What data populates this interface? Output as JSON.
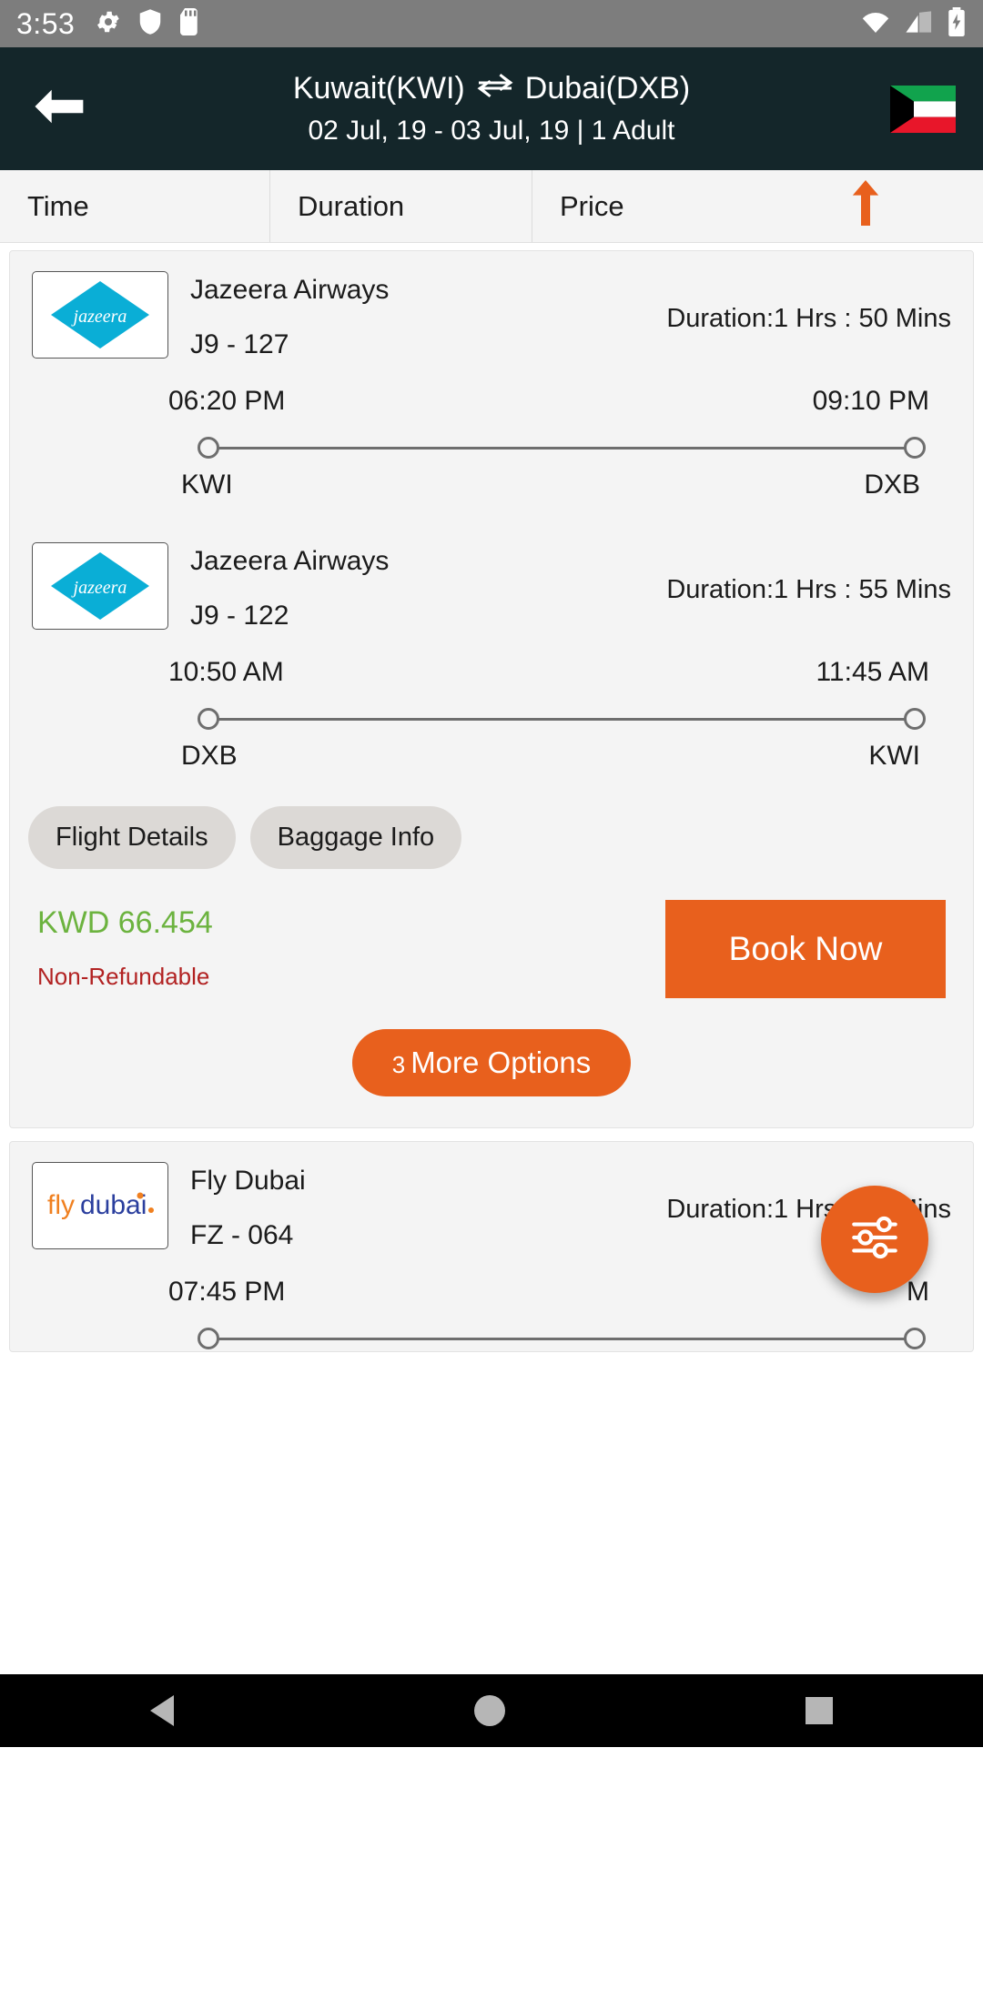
{
  "status_bar": {
    "time": "3:53",
    "left_icons": [
      "gear-icon",
      "shield-icon",
      "sd-card-icon"
    ],
    "right_icons": [
      "wifi-icon",
      "cellular-signal-icon",
      "battery-charging-icon"
    ]
  },
  "header": {
    "back_icon": "back-arrow-icon",
    "route": "Kuwait(KWI)",
    "route_separator": "⇌",
    "route_to": "Dubai(DXB)",
    "subtitle": "02 Jul, 19 - 03 Jul, 19 | 1 Adult",
    "flag": "kuwait-flag",
    "bg_color": "#14262a"
  },
  "sort_bar": {
    "columns": [
      "Time",
      "Duration",
      "Price"
    ],
    "active_sort": "Price",
    "sort_direction_icon": "arrow-up-icon",
    "sort_arrow_color": "#e8601d"
  },
  "colors": {
    "accent": "#e8601d",
    "price_green": "#6cb33f",
    "refund_red": "#b22222",
    "card_bg": "#f4f4f4"
  },
  "flights": [
    {
      "legs": [
        {
          "airline": "Jazeera Airways",
          "logo": "jazeera-airways-logo",
          "flight_number": "J9 - 127",
          "duration": "Duration:1 Hrs  : 50 Mins",
          "depart_time": "06:20 PM",
          "arrive_time": "09:10 PM",
          "origin": "KWI",
          "destination": "DXB"
        },
        {
          "airline": "Jazeera Airways",
          "logo": "jazeera-airways-logo",
          "flight_number": "J9 - 122",
          "duration": "Duration:1 Hrs  : 55 Mins",
          "depart_time": "10:50 AM",
          "arrive_time": "11:45 AM",
          "origin": "DXB",
          "destination": "KWI"
        }
      ],
      "actions": [
        "Flight Details",
        "Baggage Info"
      ],
      "price": "KWD 66.454",
      "refundable_text": "Non-Refundable",
      "book_label": "Book Now",
      "more_options_count": "3",
      "more_options_label": "More Options"
    },
    {
      "legs": [
        {
          "airline": "Fly Dubai",
          "logo": "flydubai-logo",
          "flight_number": "FZ - 064",
          "duration": "Duration:1 Hrs  : 40 Mins",
          "depart_time": "07:45 PM",
          "arrive_time": "M",
          "origin": "",
          "destination": ""
        }
      ]
    }
  ],
  "fab": {
    "icon": "filter-sliders-icon",
    "color": "#e8601d"
  },
  "nav_bar": {
    "items": [
      "back-nav-icon",
      "home-nav-icon",
      "recents-nav-icon"
    ]
  }
}
